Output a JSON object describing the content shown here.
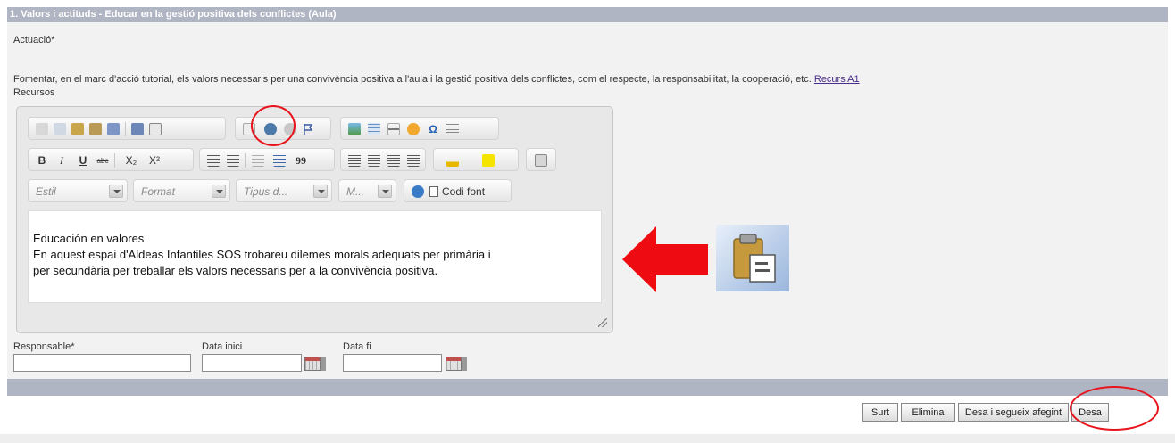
{
  "section": {
    "title": "1. Valors i actituds - Educar en la gestió positiva dels conflictes (Aula)"
  },
  "fields": {
    "actuacio_label": "Actuació*",
    "actuacio_text": "Fomentar, en el marc d'acció tutorial, els valors necessaris per una convivència positiva a l'aula i la gestió positiva dels conflictes, com el respecte, la responsabilitat, la cooperació, etc.",
    "recurs_link": "Recurs A1",
    "recursos_label": "Recursos",
    "responsable_label": "Responsable*",
    "responsable_value": "",
    "data_inici_label": "Data inici",
    "data_inici_value": "",
    "data_fi_label": "Data fi",
    "data_fi_value": ""
  },
  "editor": {
    "combos": {
      "style": "Estil",
      "format": "Format",
      "font": "Tipus d...",
      "size": "M..."
    },
    "source_label": "Codi font",
    "bold": "B",
    "italic": "I",
    "underline": "U",
    "strike": "abc",
    "subscript": "X₂",
    "superscript": "X²",
    "blockquote": "99",
    "omega": "Ω",
    "content_lines": [
      "Educación en valores",
      "En aquest espai d'Aldeas Infantiles SOS trobareu dilemes morals adequats per primària i",
      "per secundària per treballar els valors necessaris per a la convivència positiva."
    ]
  },
  "buttons": {
    "surt": "Surt",
    "elimina": "Elimina",
    "desa_segueix": "Desa i segueix afegint",
    "desa": "Desa"
  },
  "colors": {
    "header": "#b0b5c4",
    "annotation": "#e8141c",
    "link": "#4a2c8a"
  },
  "icons": [
    "cut-icon",
    "copy-icon",
    "paste-icon",
    "paste-text-icon",
    "paste-word-icon",
    "print-icon",
    "preview-icon",
    "template-icon",
    "link-icon",
    "unlink-icon",
    "anchor-icon",
    "image-icon",
    "table-icon",
    "horizontal-rule-icon",
    "smiley-icon",
    "special-char-icon",
    "page-break-icon",
    "numbered-list-icon",
    "bulleted-list-icon",
    "outdent-icon",
    "indent-icon",
    "blockquote-icon",
    "align-left-icon",
    "align-center-icon",
    "align-right-icon",
    "justify-icon",
    "text-color-icon",
    "bg-color-icon",
    "maximize-icon",
    "spellcheck-icon",
    "source-icon",
    "resize-grip-icon",
    "calendar-icon",
    "paste-large-icon",
    "red-arrow-icon"
  ]
}
